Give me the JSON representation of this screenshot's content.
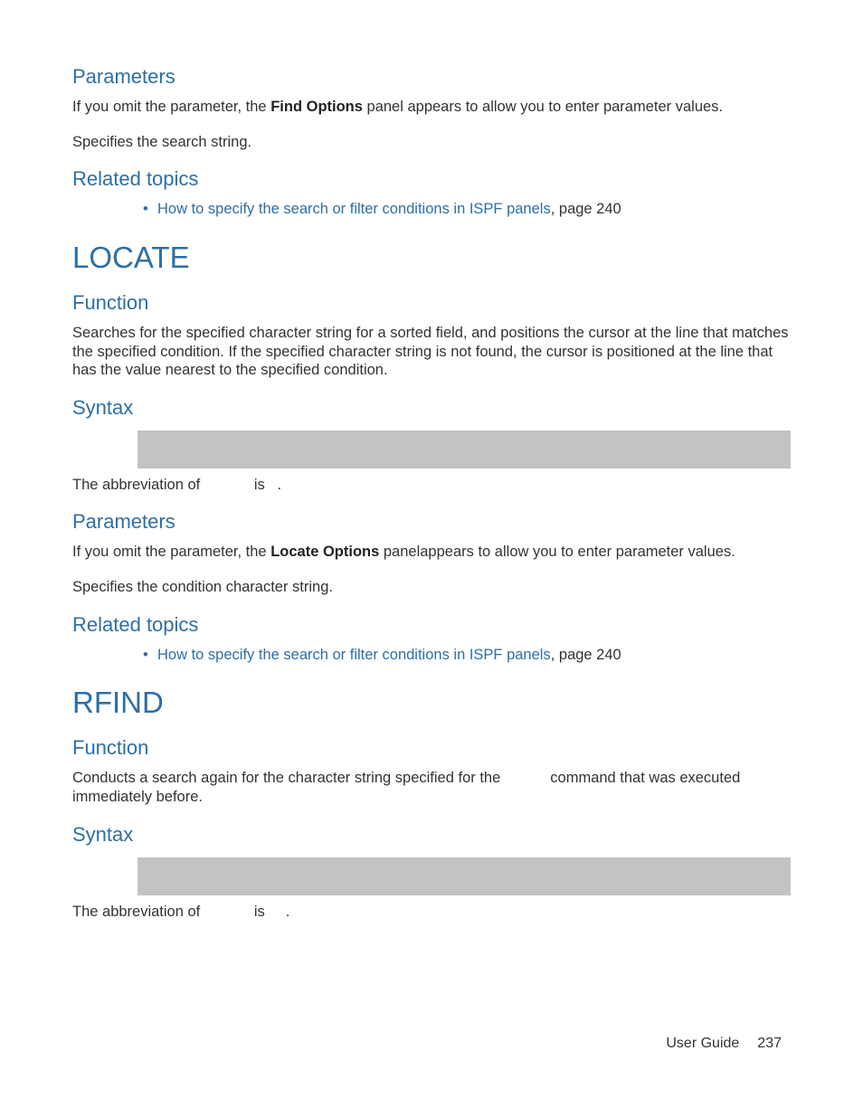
{
  "section1": {
    "h_parameters": "Parameters",
    "p1_a": "If you omit the parameter, the ",
    "p1_bold": "Find Options",
    "p1_b": " panel appears to allow you to enter parameter values.",
    "p2": "Specifies the search string.",
    "h_related": "Related topics",
    "link": "How to specify the search or filter conditions in ISPF panels",
    "link_suffix": ", page 240"
  },
  "locate": {
    "title": "LOCATE",
    "h_function": "Function",
    "func_text": "Searches for the specified character string for a sorted field, and positions the cursor at the line that matches the specified condition. If the specified character string is not found, the cursor is positioned at the line that has the value nearest to the specified condition.",
    "h_syntax": "Syntax",
    "abbrev_a": "The abbreviation of ",
    "abbrev_b": " is ",
    "abbrev_c": ".",
    "h_parameters": "Parameters",
    "p1_a": "If you omit the parameter, the ",
    "p1_bold": "Locate Options",
    "p1_b": " panelappears to allow you to enter parameter values.",
    "p2": "Specifies the condition character string.",
    "h_related": "Related topics",
    "link": "How to specify the search or filter conditions in ISPF panels",
    "link_suffix": ", page 240"
  },
  "rfind": {
    "title": "RFIND",
    "h_function": "Function",
    "func_a": "Conducts a search again for the character string specified for the ",
    "func_gap": "          ",
    "func_b": " command that was executed immediately before.",
    "h_syntax": "Syntax",
    "abbrev_a": "The abbreviation of ",
    "abbrev_b": " is ",
    "abbrev_c": "."
  },
  "footer": {
    "label": "User Guide",
    "page": "237"
  }
}
